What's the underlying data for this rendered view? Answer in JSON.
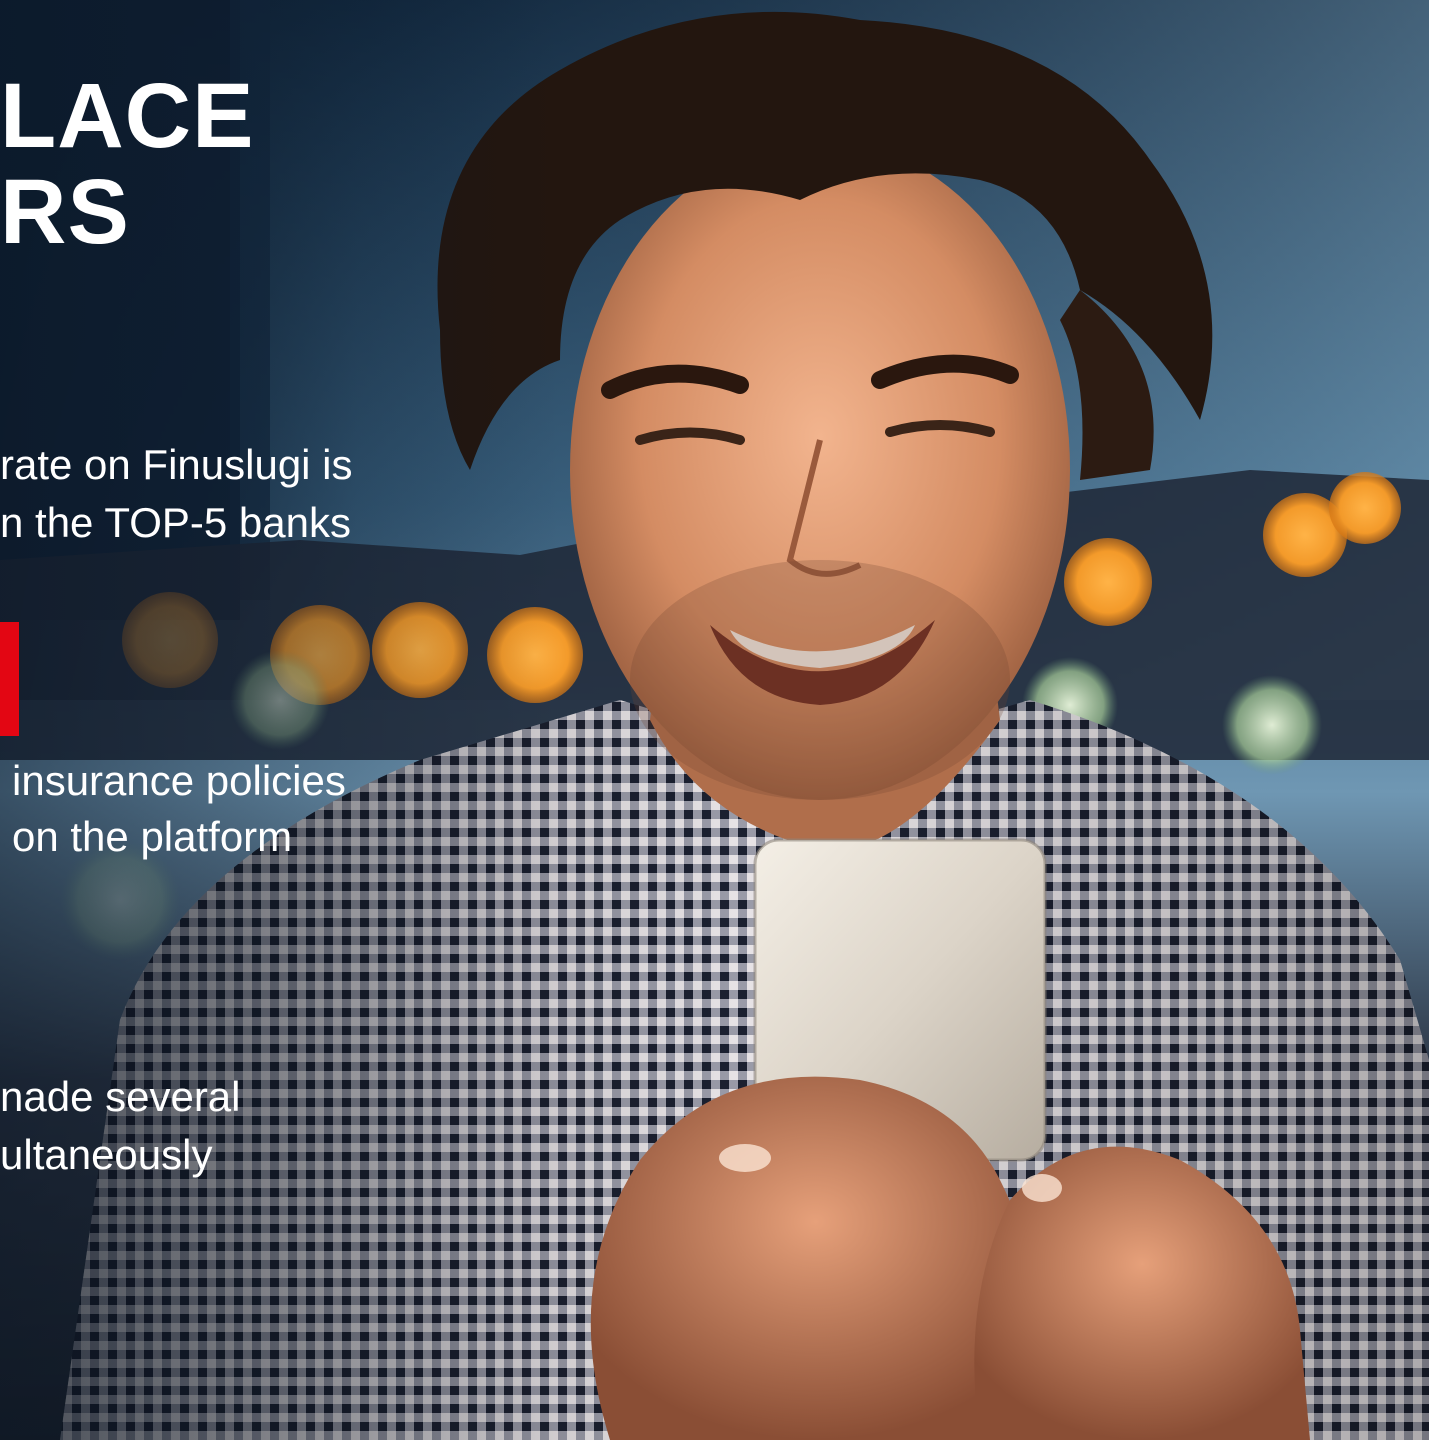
{
  "headline": {
    "line1": "LACE",
    "line2": "RS"
  },
  "stat1": {
    "line1": "rate on Finuslugi is",
    "line2": "n the TOP-5 banks"
  },
  "stat2": {
    "line1": "insurance policies",
    "line2": "on the platform"
  },
  "stat3": {
    "line1": "nade several",
    "line2": "ultaneously"
  },
  "colors": {
    "accent": "#e30613",
    "text": "#ffffff",
    "sky_top": "#1f3a55",
    "sky_bottom": "#8fb6cf"
  },
  "photo": {
    "subject": "smiling-man-with-phone"
  }
}
